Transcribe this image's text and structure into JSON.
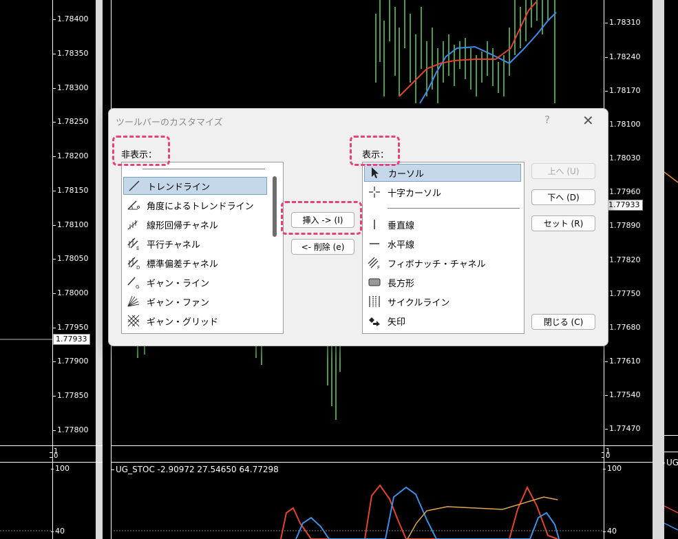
{
  "left_scale": {
    "labels": [
      "1.78400",
      "1.78350",
      "1.78300",
      "1.78250",
      "1.78200",
      "1.78150",
      "1.78100",
      "1.78050",
      "1.78000",
      "1.77950",
      "1.77900",
      "1.77850",
      "1.77800"
    ],
    "tag": "1.77933",
    "sub_top": "1",
    "sub_bottom": "0",
    "osc_top": "100",
    "osc_low": "40"
  },
  "right_scale": {
    "labels": [
      "1.78310",
      "1.78240",
      "1.78170",
      "1.78100",
      "1.78030",
      "1.77960",
      "1.77890",
      "1.77820",
      "1.77750",
      "1.77680",
      "1.77610",
      "1.77540",
      "1.77470"
    ],
    "tag": "1.77933",
    "sub_top": "1",
    "sub_bottom": "0",
    "osc_top": "100",
    "osc_low": "40"
  },
  "indicator_label": "UG_STOC -2.90972 27.54650 64.77298",
  "far_right_label": "UG",
  "dialog": {
    "title": "ツールバーのカスタマイズ",
    "help": "?",
    "close": "✕",
    "hidden_label": "非表示：",
    "shown_label": "表示：",
    "hidden_items": [
      {
        "label": "トレンドライン",
        "icon": "trendline-icon"
      },
      {
        "label": "角度によるトレンドライン",
        "icon": "angle-trendline-icon"
      },
      {
        "label": "線形回帰チャネル",
        "icon": "regression-channel-icon"
      },
      {
        "label": "平行チャネル",
        "icon": "parallel-channel-icon"
      },
      {
        "label": "標準偏差チャネル",
        "icon": "stddev-channel-icon"
      },
      {
        "label": "ギャン・ライン",
        "icon": "gann-line-icon"
      },
      {
        "label": "ギャン・ファン",
        "icon": "gann-fan-icon"
      },
      {
        "label": "ギャン・グリッド",
        "icon": "gann-grid-icon"
      }
    ],
    "shown_items": [
      {
        "label": "カーソル",
        "icon": "cursor-icon"
      },
      {
        "label": "十字カーソル",
        "icon": "crosshair-icon"
      },
      {
        "label": "垂直線",
        "icon": "vertical-line-icon"
      },
      {
        "label": "水平線",
        "icon": "horizontal-line-icon"
      },
      {
        "label": "フィボナッチ・チャネル",
        "icon": "fibonacci-channel-icon"
      },
      {
        "label": "長方形",
        "icon": "rectangle-icon"
      },
      {
        "label": "サイクルライン",
        "icon": "cycle-lines-icon"
      },
      {
        "label": "矢印",
        "icon": "arrow-icon"
      }
    ],
    "buttons": {
      "insert": "挿入 -> (I)",
      "remove": "<- 削除 (e)",
      "up": "上へ (U)",
      "down": "下へ (D)",
      "reset": "セット (R)",
      "close": "閉じる (C)"
    }
  }
}
